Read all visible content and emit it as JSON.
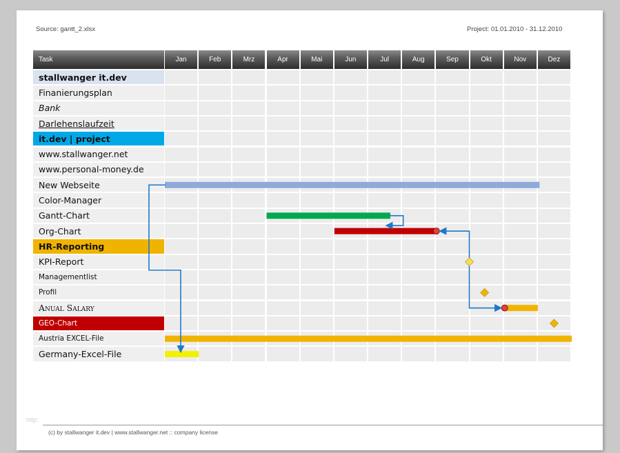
{
  "header": {
    "source": "Source: gantt_2.xlsx",
    "project": "Project: 01.01.2010 - 31.12.2010"
  },
  "footer": {
    "watermark": "http:",
    "copyright": "(c) by stallwanger  it.dev | www.stallwanger.net  :: company license"
  },
  "colors": {
    "header_dark": "#2d2d2d",
    "section_it_dev": "#d9e2ef",
    "section_project": "#00a8e8",
    "section_hr": "#f0b400",
    "section_geo": "#c00000",
    "bar_blue": "#8eaadc",
    "bar_green": "#00a84f",
    "bar_red": "#c00000",
    "bar_orange": "#f0b400",
    "bar_yellow": "#f2f200",
    "arrow": "#1f78c8",
    "milestone": "#f0b400",
    "milestone_light": "#f7dd5a"
  },
  "chart_data": {
    "type": "gantt",
    "task_header": "Task",
    "months": [
      "Jan",
      "Feb",
      "Mrz",
      "Apr",
      "Mai",
      "Jun",
      "Jul",
      "Aug",
      "Sep",
      "Okt",
      "Nov",
      "Dez"
    ],
    "project_range": [
      "01.01.2010",
      "31.12.2010"
    ],
    "tasks": [
      {
        "name": "stallwanger it.dev",
        "style": "section",
        "fill": "section_it_dev",
        "bold": true
      },
      {
        "name": "Finanierungsplan"
      },
      {
        "name": "Bank",
        "italic": true
      },
      {
        "name": "Darlehenslaufzeit",
        "underline": true
      },
      {
        "name": "it.dev | project",
        "style": "section",
        "fill": "section_project",
        "bold": true
      },
      {
        "name": "www.stallwanger.net"
      },
      {
        "name": "www.personal-money.de"
      },
      {
        "name": "New Webseite",
        "bar": {
          "start": 0.0,
          "end": 11.05,
          "color": "bar_blue"
        }
      },
      {
        "name": "Color-Manager"
      },
      {
        "name": "Gantt-Chart",
        "bar": {
          "start": 3.0,
          "end": 6.65,
          "color": "bar_green"
        }
      },
      {
        "name": "Org-Chart",
        "bar": {
          "start": 5.0,
          "end": 8.05,
          "color": "bar_red"
        },
        "end_marker": true
      },
      {
        "name": "HR-Reporting",
        "style": "section",
        "fill": "section_hr",
        "bold": true
      },
      {
        "name": "KPI-Report",
        "milestone": {
          "at": 9.0,
          "color": "milestone_light"
        }
      },
      {
        "name": "Managementlist",
        "small": true
      },
      {
        "name": "Profil",
        "small": true,
        "milestone": {
          "at": 9.45,
          "color": "milestone"
        }
      },
      {
        "name": "Anual Salary",
        "smallcaps": true,
        "bar": {
          "start": 10.0,
          "end": 11.0,
          "color": "bar_orange"
        },
        "start_marker": true
      },
      {
        "name": "GEO-Chart",
        "style": "section",
        "fill": "section_geo",
        "small": true,
        "milestone": {
          "at": 11.5,
          "color": "milestone"
        }
      },
      {
        "name": "Austria EXCEL-File",
        "small": true,
        "bar": {
          "start": 0.0,
          "end": 12.0,
          "color": "bar_orange"
        }
      },
      {
        "name": "Germany-Excel-File",
        "bar": {
          "start": 0.0,
          "end": 1.0,
          "color": "bar_yellow"
        }
      }
    ],
    "dependencies": [
      {
        "from": "New Webseite",
        "to": "Germany-Excel-File"
      },
      {
        "from": "Org-Chart",
        "to": "Gantt-Chart"
      },
      {
        "from": "KPI-Report",
        "to": "Org-Chart"
      },
      {
        "from": "KPI-Report",
        "to": "Anual Salary"
      }
    ]
  }
}
